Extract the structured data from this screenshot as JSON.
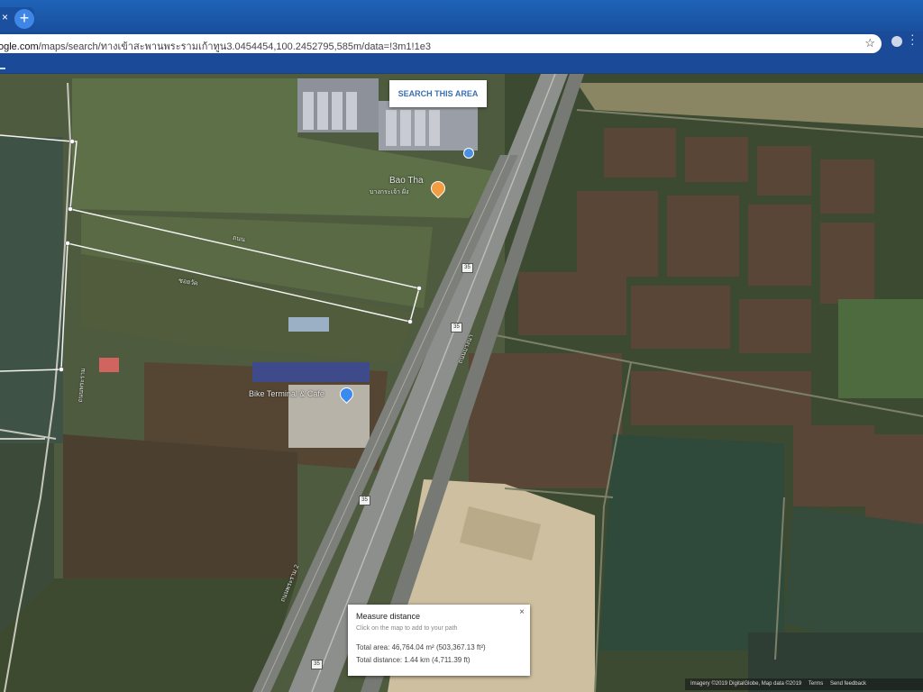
{
  "browser": {
    "tab_close": "×",
    "new_tab": "+",
    "url_host": "ogle.com",
    "url_path": "/maps/search/ทางเข้าสะพานพระรามเก้าทูน3.0454454,100.2452795,585m/data=!3m1!1e3",
    "star": "☆"
  },
  "map": {
    "search_button": "SEARCH THIS AREA",
    "places": {
      "place1": "Bao Tha",
      "place1_sub": "บางกระเจ้า ฝั่ง",
      "place2": "Bike Terminal & Cafe"
    },
    "road_labels": {
      "r1": "ถนนพระราม",
      "r2": "ซอยวัด",
      "r3": "ถนนบางนา",
      "r4": "ถนนพระราม 2",
      "r5": "ถนน"
    },
    "route_shields": [
      "35",
      "35",
      "35",
      "35"
    ],
    "attribution": {
      "imagery": "Imagery ©2019 DigitalGlobe, Map data ©2019",
      "terms": "Terms",
      "feedback": "Send feedback"
    }
  },
  "measure": {
    "title": "Measure distance",
    "hint": "Click on the map to add to your path",
    "total_area": "Total area: 46,764.04 m² (503,367.13 ft²)",
    "total_distance": "Total distance: 1.44 km (4,711.39 ft)",
    "close": "×"
  }
}
